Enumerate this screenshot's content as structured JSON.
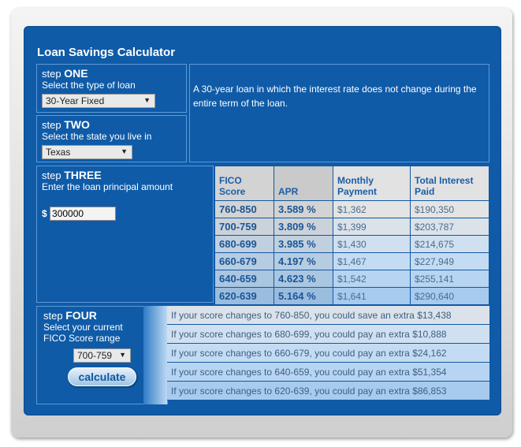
{
  "title": "Loan Savings Calculator",
  "step1": {
    "step": "step",
    "num": "ONE",
    "instr": "Select the type of loan",
    "value": "30-Year Fixed"
  },
  "step2": {
    "step": "step",
    "num": "TWO",
    "instr": "Select the state you live in",
    "value": "Texas"
  },
  "description": "A 30-year loan in which the interest rate does not change during the entire term of the loan.",
  "step3": {
    "step": "step",
    "num": "THREE",
    "instr": "Enter the loan principal amount",
    "currency": "$",
    "value": "300000"
  },
  "table": {
    "headers": [
      "FICO Score",
      "APR",
      "Monthly Payment",
      "Total Interest Paid"
    ],
    "rows": [
      [
        "760-850",
        "3.589 %",
        "$1,362",
        "$190,350"
      ],
      [
        "700-759",
        "3.809 %",
        "$1,399",
        "$203,787"
      ],
      [
        "680-699",
        "3.985 %",
        "$1,430",
        "$214,675"
      ],
      [
        "660-679",
        "4.197 %",
        "$1,467",
        "$227,949"
      ],
      [
        "640-659",
        "4.623 %",
        "$1,542",
        "$255,141"
      ],
      [
        "620-639",
        "5.164 %",
        "$1,641",
        "$290,640"
      ]
    ],
    "row_colors": [
      "#e4e4e4",
      "#dbe2ea",
      "#d0e0f0",
      "#c4dcf3",
      "#b7d5f2",
      "#a6cbef"
    ]
  },
  "step4": {
    "step": "step",
    "num": "FOUR",
    "instr": "Select your current FICO Score range",
    "value": "700-759",
    "button": "calculate"
  },
  "messages": [
    "If your score changes to 760-850, you could save an extra $13,438",
    "If your score changes to 680-699, you could pay an extra $10,888",
    "If your score changes to 660-679, you could pay an extra $24,162",
    "If your score changes to 640-659, you could pay an extra $51,354",
    "If your score changes to 620-639, you could pay an extra $86,853"
  ]
}
